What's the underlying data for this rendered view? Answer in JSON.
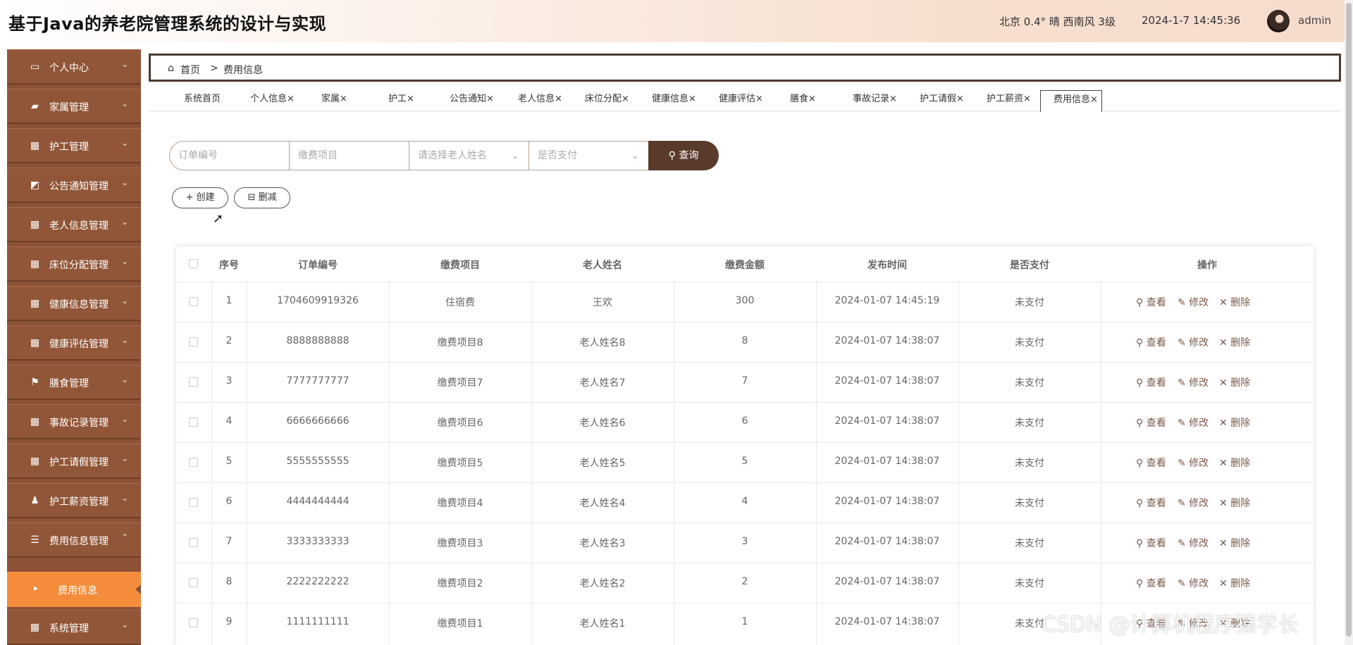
{
  "header": {
    "title": "基于Java的养老院管理系统的设计与实现",
    "weather": "北京  0.4°  晴  西南风  3级",
    "datetime": "2024-1-7 14:45:36",
    "user": "admin"
  },
  "sidebar": {
    "items": [
      {
        "label": "个人中心",
        "icon": "▭",
        "chevron": "⌄"
      },
      {
        "label": "家属管理",
        "icon": "▰",
        "chevron": "⌄"
      },
      {
        "label": "护工管理",
        "icon": "▦",
        "chevron": "⌄"
      },
      {
        "label": "公告通知管理",
        "icon": "◩",
        "chevron": "⌄"
      },
      {
        "label": "老人信息管理",
        "icon": "▦",
        "chevron": "⌄"
      },
      {
        "label": "床位分配管理",
        "icon": "▦",
        "chevron": "⌄"
      },
      {
        "label": "健康信息管理",
        "icon": "▦",
        "chevron": "⌄"
      },
      {
        "label": "健康评估管理",
        "icon": "▦",
        "chevron": "⌄"
      },
      {
        "label": "膳食管理",
        "icon": "⚑",
        "chevron": "⌄"
      },
      {
        "label": "事故记录管理",
        "icon": "▦",
        "chevron": "⌄"
      },
      {
        "label": "护工请假管理",
        "icon": "▦",
        "chevron": "⌄"
      },
      {
        "label": "护工薪资管理",
        "icon": "♟",
        "chevron": "⌄"
      },
      {
        "label": "费用信息管理",
        "icon": "☰",
        "chevron": "⌃"
      }
    ],
    "sub_item": {
      "label": "费用信息",
      "icon": "▸"
    },
    "last_item": {
      "label": "系统管理",
      "icon": "▦",
      "chevron": "⌄"
    }
  },
  "breadcrumb": {
    "home_icon": "⌂",
    "home": "首页",
    "separator": ">",
    "current": "费用信息"
  },
  "tabs": [
    "系统首页",
    "个人信息×",
    "家属×",
    "护工×",
    "公告通知×",
    "老人信息×",
    "床位分配×",
    "健康信息×",
    "健康评估×",
    "膳食×",
    "事故记录×",
    "护工请假×",
    "护工薪资×",
    "费用信息×"
  ],
  "search": {
    "order_placeholder": "订单编号",
    "item_placeholder": "缴费项目",
    "elder_placeholder": "请选择老人姓名",
    "paid_placeholder": "是否支付",
    "chevron": "⌄",
    "button_icon": "⚲",
    "button": "查询"
  },
  "actions": {
    "create": "+ 创建",
    "delete": "⊟ 删减"
  },
  "table": {
    "headers": [
      "序号",
      "订单编号",
      "缴费项目",
      "老人姓名",
      "缴费金额",
      "发布时间",
      "是否支付",
      "操作"
    ],
    "rows": [
      [
        "1",
        "1704609919326",
        "住宿费",
        "王欢",
        "300",
        "2024-01-07 14:45:19",
        "未支付"
      ],
      [
        "2",
        "8888888888",
        "缴费项目8",
        "老人姓名8",
        "8",
        "2024-01-07 14:38:07",
        "未支付"
      ],
      [
        "3",
        "7777777777",
        "缴费项目7",
        "老人姓名7",
        "7",
        "2024-01-07 14:38:07",
        "未支付"
      ],
      [
        "4",
        "6666666666",
        "缴费项目6",
        "老人姓名6",
        "6",
        "2024-01-07 14:38:07",
        "未支付"
      ],
      [
        "5",
        "5555555555",
        "缴费项目5",
        "老人姓名5",
        "5",
        "2024-01-07 14:38:07",
        "未支付"
      ],
      [
        "6",
        "4444444444",
        "缴费项目4",
        "老人姓名4",
        "4",
        "2024-01-07 14:38:07",
        "未支付"
      ],
      [
        "7",
        "3333333333",
        "缴费项目3",
        "老人姓名3",
        "3",
        "2024-01-07 14:38:07",
        "未支付"
      ],
      [
        "8",
        "2222222222",
        "缴费项目2",
        "老人姓名2",
        "2",
        "2024-01-07 14:38:07",
        "未支付"
      ],
      [
        "9",
        "1111111111",
        "缴费项目1",
        "老人姓名1",
        "1",
        "2024-01-07 14:38:07",
        "未支付"
      ]
    ],
    "ops": {
      "view": "⚲ 查看",
      "edit": "✎ 修改",
      "delete": "✕ 删除"
    }
  },
  "watermark": "CSDN @计算机程序猿学长",
  "colors": {
    "sidebar": "#8c5236",
    "active_sub": "#f58c3b",
    "search_button": "#5a3a2a"
  }
}
